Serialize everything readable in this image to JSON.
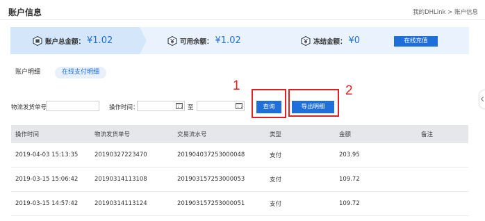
{
  "header": {
    "title": "账户信息",
    "breadcrumb": "我的DHLink > 账户信息"
  },
  "summary": {
    "total_label": "账户总金额：",
    "total_value": "¥1.02",
    "available_label": "可用余额：",
    "available_value": "¥1.02",
    "frozen_label": "冻结金额：",
    "frozen_value": "¥0",
    "recharge_button": "在线充值",
    "icons": [
      "wallet-icon",
      "yen-icon",
      "yen-icon"
    ]
  },
  "tabs": [
    {
      "label": "账户明细",
      "active": false
    },
    {
      "label": "在线支付明细",
      "active": true
    }
  ],
  "filters": {
    "order_label": "物流发货单号",
    "order_value": "",
    "time_label": "操作时间：",
    "start_value": "",
    "to_label": "至",
    "end_value": "",
    "query_button": "查询",
    "export_button": "导出明细"
  },
  "annotations": [
    "1",
    "2"
  ],
  "table": {
    "headers": [
      "操作时间",
      "物流发货单号",
      "交易流水号",
      "类型",
      "金额",
      "备注"
    ],
    "rows": [
      [
        "2019-04-03 15:13:35",
        "20190327223470",
        "201904037253000048",
        "支付",
        "203.95",
        ""
      ],
      [
        "2019-03-15 15:06:42",
        "20190314113108",
        "201903157253000053",
        "支付",
        "109.72",
        ""
      ],
      [
        "2019-03-15 14:57:42",
        "20190314113124",
        "201903157253000051",
        "支付",
        "109.72",
        ""
      ]
    ]
  },
  "colors": {
    "accent": "#1e6fd9",
    "annotation": "#e02020",
    "summary_bg": "#eaf3fd",
    "table_header_bg": "#e5e7eb"
  }
}
